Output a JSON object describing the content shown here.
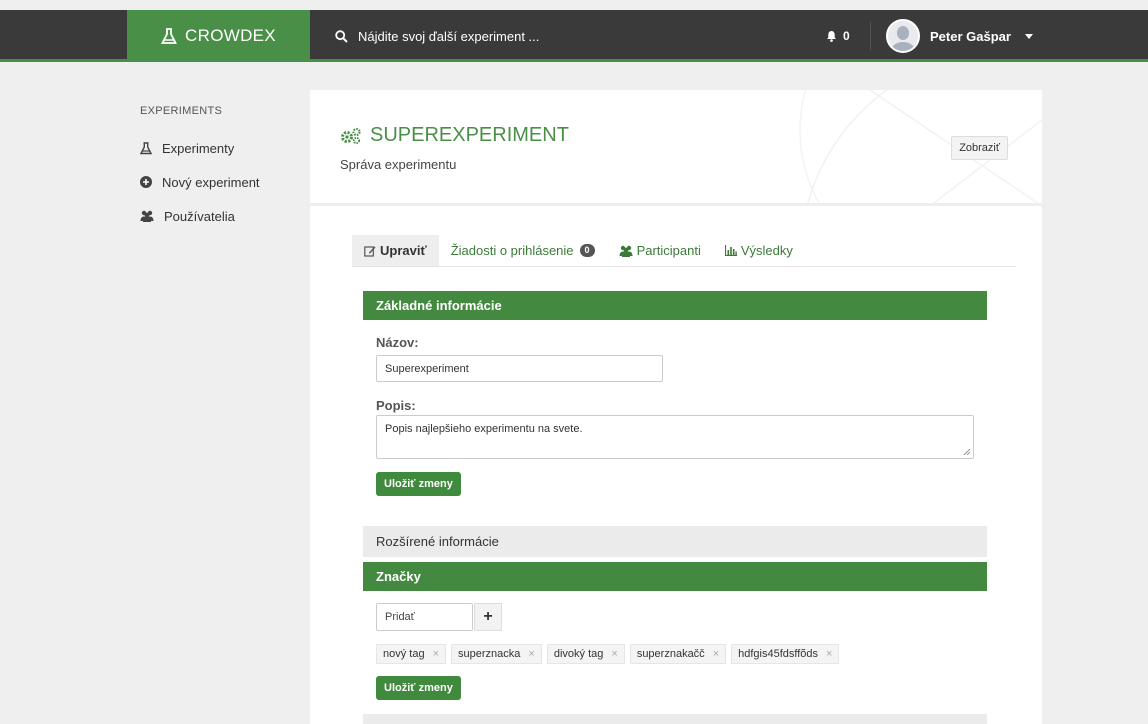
{
  "topbar": {
    "brand": "CROWDEX",
    "search_placeholder": "Nájdite svoj ďalší experiment ...",
    "notifications_count": "0",
    "user_name": "Peter Gašpar"
  },
  "sidebar": {
    "heading": "EXPERIMENTS",
    "items": [
      {
        "label": "Experimenty",
        "icon": "flask-icon"
      },
      {
        "label": "Nový experiment",
        "icon": "plus-circle-icon"
      },
      {
        "label": "Používatelia",
        "icon": "users-icon"
      }
    ]
  },
  "experiment": {
    "title": "SUPEREXPERIMENT",
    "subtitle": "Správa experimentu",
    "show_button": "Zobraziť"
  },
  "tabs": [
    {
      "label": "Upraviť",
      "active": true
    },
    {
      "label": "Žiadosti o prihlásenie",
      "badge": "0"
    },
    {
      "label": "Participanti"
    },
    {
      "label": "Výsledky"
    }
  ],
  "basic_info": {
    "heading": "Základné informácie",
    "name_label": "Názov:",
    "name_value": "Superexperiment",
    "desc_label": "Popis:",
    "desc_value": "Popis najlepšieho experimentu na svete.",
    "save_label": "Uložiť zmeny"
  },
  "extended_info": {
    "heading": "Rozšírené informácie"
  },
  "tags_section": {
    "heading": "Značky",
    "add_placeholder": "Pridať",
    "add_button": "+",
    "remove_glyph": "×",
    "tags": [
      "nový tag",
      "superznacka",
      "divoký tag",
      "superznakačč",
      "hdfgis45fdsffõds"
    ],
    "save_label": "Uložiť zmeny"
  },
  "colors": {
    "brand_green": "#4a8f47",
    "topbar_dark": "#3a3a3a",
    "link_green": "#3b7a38"
  }
}
